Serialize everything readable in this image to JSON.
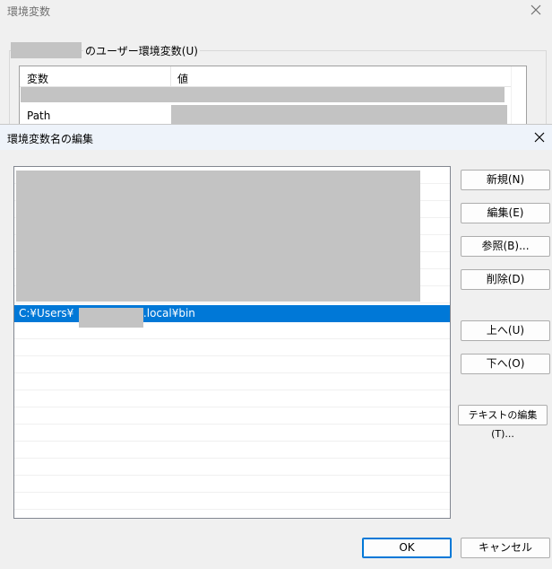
{
  "background_window": {
    "title": "環境変数",
    "group_label": "のユーザー環境変数(U)",
    "columns": [
      "変数",
      "値"
    ],
    "row_path_label": "Path"
  },
  "dialog": {
    "title": "環境変数名の編集",
    "selected_entry": {
      "prefix": "C:¥Users¥",
      "suffix": "¥.local¥bin"
    },
    "buttons": {
      "new": "新規(N)",
      "edit": "編集(E)",
      "browse": "参照(B)...",
      "delete": "削除(D)",
      "up": "上へ(U)",
      "down": "下へ(O)",
      "text_edit": "テキストの編集(T)...",
      "ok": "OK",
      "cancel": "キャンセル"
    }
  },
  "colors": {
    "selection": "#0078d7",
    "redaction": "#c3c3c3",
    "titlebar": "#eef3fa"
  },
  "icons": {
    "close": "close-icon"
  }
}
